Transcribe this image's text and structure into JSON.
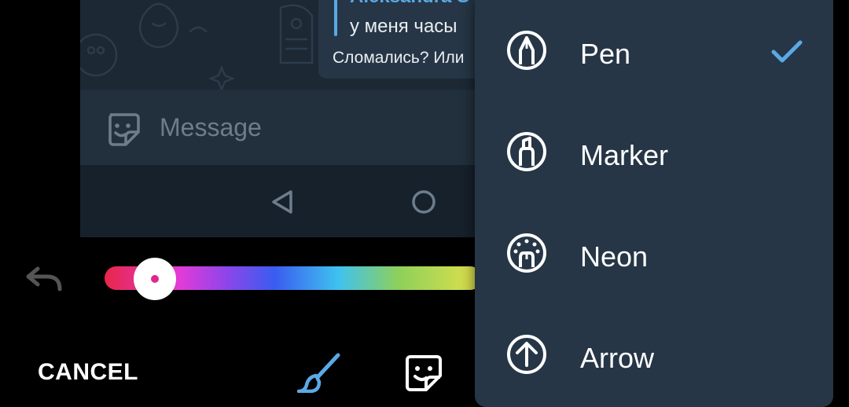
{
  "chat": {
    "reply_name": "Aleksandra S",
    "reply_text": "у меня часы",
    "message_text": "Сломались? Или",
    "input_placeholder": "Message"
  },
  "controls": {
    "cancel_label": "CANCEL",
    "color_slider_value": 0.13,
    "selected_color": "#e0288c"
  },
  "menu": {
    "items": [
      {
        "label": "Pen",
        "icon": "pen-icon",
        "checked": true
      },
      {
        "label": "Marker",
        "icon": "marker-icon",
        "checked": false
      },
      {
        "label": "Neon",
        "icon": "neon-icon",
        "checked": false
      },
      {
        "label": "Arrow",
        "icon": "arrow-icon",
        "checked": false
      }
    ]
  },
  "colors": {
    "accent": "#5aa9e6",
    "menu_bg": "#263646",
    "chat_bg": "#1c2834"
  }
}
